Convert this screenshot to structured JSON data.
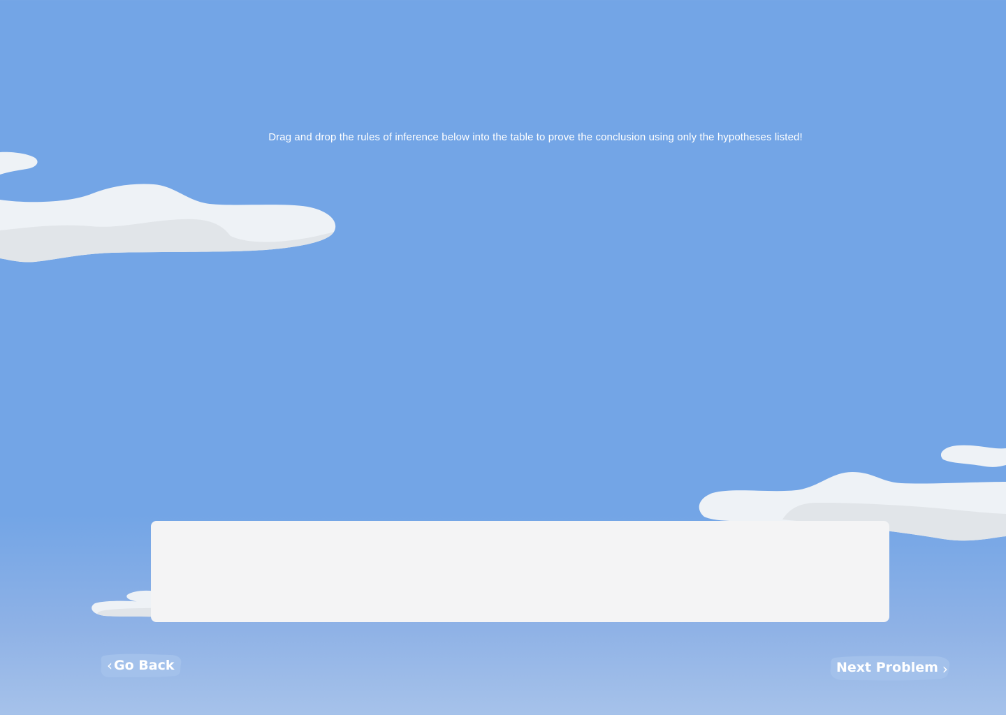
{
  "instruction": "Drag and drop the rules of inference below into the table to prove the conclusion using only the hypotheses listed!",
  "nav": {
    "back": {
      "label": "Go Back",
      "icon": "chevron-left-icon"
    },
    "next": {
      "label": "Next Problem",
      "icon": "chevron-right-icon"
    }
  },
  "colors": {
    "sky": "#73a5e6",
    "cloud_light": "#eef2f6",
    "cloud_shadow": "#e0e4e8",
    "tray": "#f4f4f5",
    "button_blob": "#a3c1eb",
    "text": "#ffffff"
  }
}
